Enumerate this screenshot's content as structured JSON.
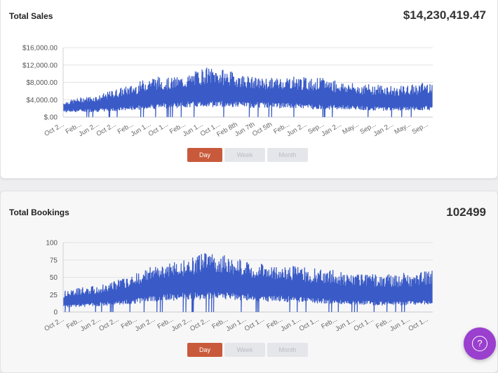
{
  "sales": {
    "title": "Total Sales",
    "total": "$14,230,419.47",
    "buttons": [
      "Day",
      "Week",
      "Month"
    ],
    "active_button": "Day"
  },
  "bookings": {
    "title": "Total Bookings",
    "total": "102499",
    "buttons": [
      "Day",
      "Week",
      "Month"
    ],
    "active_button": "Day"
  },
  "help": {
    "icon": "help-circle-icon",
    "color": "#9b3fcf"
  },
  "colors": {
    "series": "#3a5bc7",
    "grid": "#e3e3e6",
    "active_button": "#c85a3b"
  },
  "chart_data": [
    {
      "type": "line",
      "title": "Total Sales",
      "ylim": [
        0,
        16000
      ],
      "y_ticks": [
        0,
        4000,
        8000,
        12000,
        16000
      ],
      "y_tick_labels": [
        "$.00",
        "$4,000.00",
        "$8,000.00",
        "$12,000.00",
        "$16,000.00"
      ],
      "x_tick_labels": [
        "Oct 2...",
        "Feb...",
        "Jun 2...",
        "Oct 2...",
        "Feb...",
        "Jun 1...",
        "Oct 1...",
        "Feb...",
        "Jun 1...",
        "Oct 1...",
        "Feb 8th",
        "Jun 7th",
        "Oct 5th",
        "Feb...",
        "Jun 2...",
        "Sep...",
        "Jan 2...",
        "May...",
        "Sep...",
        "Jan 2...",
        "May...",
        "Sep..."
      ],
      "grid": true,
      "series": [
        {
          "color": "#3a5bc7",
          "points_per_anchor": 26,
          "baseline": [
            2000,
            2200,
            2300,
            2600,
            3000,
            3500,
            3800,
            4100,
            4300,
            4300,
            4100,
            4000,
            3900,
            3700,
            3500,
            3300,
            3200,
            3000,
            2800,
            2800,
            2900,
            3000
          ],
          "peak": [
            3500,
            4500,
            5000,
            6500,
            7500,
            9500,
            9000,
            9500,
            11500,
            11000,
            10000,
            9000,
            9000,
            9500,
            9000,
            9000,
            8000,
            7500,
            7500,
            7000,
            7500,
            8500
          ]
        }
      ]
    },
    {
      "type": "line",
      "title": "Total Bookings",
      "ylim": [
        0,
        100
      ],
      "y_ticks": [
        0,
        25,
        50,
        75,
        100
      ],
      "y_tick_labels": [
        "0",
        "25",
        "50",
        "75",
        "100"
      ],
      "x_tick_labels": [
        "Oct 2...",
        "Feb...",
        "Jun 2...",
        "Oct 2...",
        "Feb...",
        "Jun 2...",
        "Feb...",
        "Jun 2...",
        "Oct 2...",
        "Feb...",
        "Jun 1...",
        "Oct 1...",
        "Feb...",
        "Jun 1...",
        "Oct 1...",
        "Feb...",
        "Jun 1...",
        "Oct 1...",
        "Feb...",
        "Jun 1...",
        "Oct 1..."
      ],
      "grid": true,
      "series": [
        {
          "color": "#3a5bc7",
          "points_per_anchor": 26,
          "baseline": [
            13,
            14,
            16,
            18,
            22,
            27,
            30,
            32,
            33,
            33,
            31,
            29,
            27,
            26,
            24,
            22,
            20,
            19,
            18,
            18,
            19,
            20
          ],
          "peak": [
            30,
            35,
            38,
            45,
            55,
            65,
            70,
            75,
            85,
            82,
            77,
            70,
            66,
            66,
            63,
            62,
            57,
            55,
            54,
            55,
            57,
            60
          ]
        }
      ]
    }
  ]
}
